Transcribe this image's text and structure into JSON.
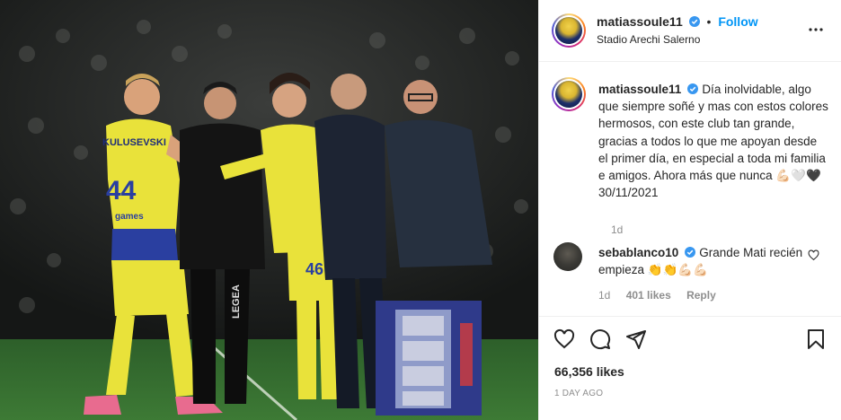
{
  "photo": {
    "description_icon": "match-photo",
    "player_left_name": "KULUSEVSKI",
    "player_left_number": "44",
    "player_left_sponsor": "games",
    "player_right_number": "46",
    "board_brand": "LEGEA",
    "board_label": "LEGEA"
  },
  "post": {
    "username": "matiassoule11",
    "follow_label": "Follow",
    "separator": "•",
    "location": "Stadio Arechi Salerno",
    "caption_username": "matiassoule11",
    "caption_text": "Día inolvidable, algo que siempre soñé y mas con estos colores hermosos, con este club tan grande, gracias a todos lo que me apoyan desde el primer día, en especial a toda mi familia e amigos. Ahora más que nunca 💪🏻🤍🖤 30/11/2021",
    "caption_age": "1d",
    "likes": "66,356 likes",
    "time_ago": "1 DAY AGO"
  },
  "comment": {
    "username": "sebablanco10",
    "text": "Grande Mati recién empieza 👏👏💪🏻💪🏻",
    "age": "1d",
    "likes": "401 likes",
    "reply": "Reply"
  },
  "colors": {
    "accent": "#0095f6",
    "verified": "#3897f0",
    "muted": "#8e8e8e",
    "text": "#262626",
    "border": "#efefef"
  },
  "icons": {
    "more": "more-horizontal-icon",
    "heart": "heart-icon",
    "comment": "comment-icon",
    "share": "share-icon",
    "save": "bookmark-icon",
    "verified": "verified-badge-icon"
  }
}
